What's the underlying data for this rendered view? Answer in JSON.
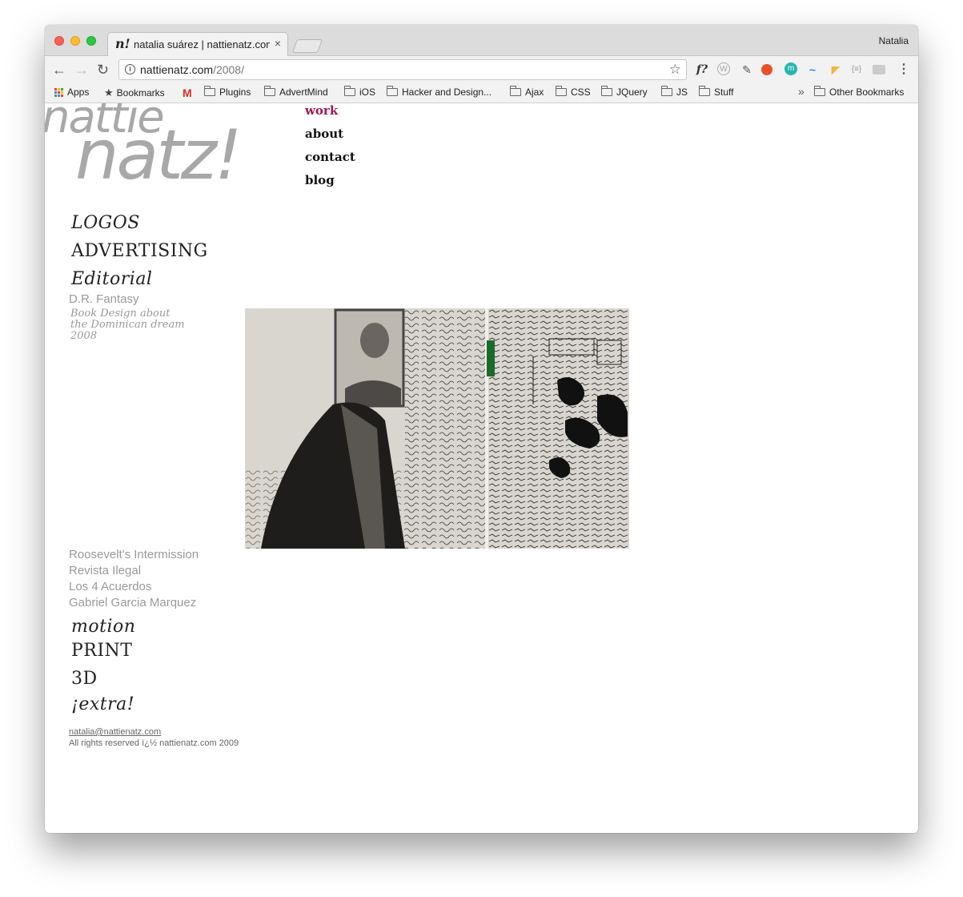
{
  "browser": {
    "tab_favicon": "n!",
    "tab_title": "natalia suárez | nattienatz.com",
    "tab_close": "×",
    "profile_name": "Natalia",
    "url_host": "nattienatz.com",
    "url_path": "/2008/",
    "nav": {
      "back": "←",
      "forward": "→",
      "reload": "↻",
      "star": "☆",
      "menu": "⋮"
    },
    "extensions": [
      "f?",
      "W",
      "pipette",
      "fire",
      "m",
      "~",
      "tag",
      "{≡}",
      "grey",
      "menu"
    ]
  },
  "bookmarks": [
    {
      "label": "Apps",
      "icon": "apps-grid-icon"
    },
    {
      "label": "Bookmarks",
      "icon": "star-icon"
    },
    {
      "label": "M",
      "icon": "gmail-icon"
    },
    {
      "label": "Plugins",
      "icon": "folder-icon"
    },
    {
      "label": "AdvertMind",
      "icon": "folder-icon"
    },
    {
      "label": "iOS",
      "icon": "folder-icon"
    },
    {
      "label": "Hacker and Design...",
      "icon": "folder-icon"
    },
    {
      "label": "Ajax",
      "icon": "folder-icon"
    },
    {
      "label": "CSS",
      "icon": "folder-icon"
    },
    {
      "label": "JQuery",
      "icon": "folder-icon"
    },
    {
      "label": "JS",
      "icon": "folder-icon"
    },
    {
      "label": "Stuff",
      "icon": "folder-icon"
    }
  ],
  "bookmarks_overflow": "»",
  "other_bookmarks": "Other Bookmarks",
  "site": {
    "logo_line1": "nattie",
    "logo_line2": "natz!",
    "nav": [
      "work",
      "about",
      "contact",
      "blog"
    ],
    "active_nav": "work",
    "accent_color": "#a0184f",
    "categories_top": [
      "LOGOS",
      "ADVERTISING",
      "Editorial"
    ],
    "current_project": "D.R. Fantasy",
    "project_desc": [
      "Book Design about",
      "the Dominican dream",
      "2008"
    ],
    "editorial_projects": [
      "Roosevelt's Intermission",
      "Revista Ilegal",
      "Los 4 Acuerdos",
      "Gabriel Garcia Marquez"
    ],
    "categories_bottom": [
      "motion",
      "PRINT",
      "3D",
      "¡extra!"
    ],
    "footer_email": "natalia@nattienatz.com",
    "footer_rights": "All rights reserved ï¿½ nattienatz.com 2009"
  }
}
